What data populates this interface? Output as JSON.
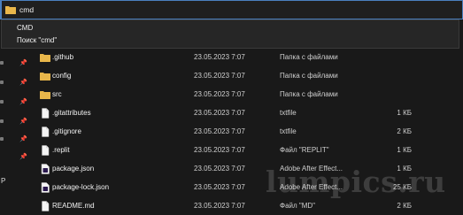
{
  "address": {
    "value": "cmd"
  },
  "suggestions": [
    "CMD",
    "Поиск \"cmd\""
  ],
  "left_pane": {
    "visible_letter": "P"
  },
  "files": [
    {
      "name": ".github",
      "date": "23.05.2023 7:07",
      "type": "Папка с файлами",
      "size": "",
      "kind": "folder"
    },
    {
      "name": "config",
      "date": "23.05.2023 7:07",
      "type": "Папка с файлами",
      "size": "",
      "kind": "folder"
    },
    {
      "name": "src",
      "date": "23.05.2023 7:07",
      "type": "Папка с файлами",
      "size": "",
      "kind": "folder"
    },
    {
      "name": ".gitattributes",
      "date": "23.05.2023 7:07",
      "type": "txtfile",
      "size": "1 КБ",
      "kind": "file"
    },
    {
      "name": ".gitignore",
      "date": "23.05.2023 7:07",
      "type": "txtfile",
      "size": "2 КБ",
      "kind": "file"
    },
    {
      "name": ".replit",
      "date": "23.05.2023 7:07",
      "type": "Файл \"REPLIT\"",
      "size": "1 КБ",
      "kind": "file"
    },
    {
      "name": "package.json",
      "date": "23.05.2023 7:07",
      "type": "Adobe After Effect...",
      "size": "1 КБ",
      "kind": "file-ae"
    },
    {
      "name": "package-lock.json",
      "date": "23.05.2023 7:07",
      "type": "Adobe After Effect...",
      "size": "25 КБ",
      "kind": "file-ae"
    },
    {
      "name": "README.md",
      "date": "23.05.2023 7:07",
      "type": "Файл \"MD\"",
      "size": "2 КБ",
      "kind": "file"
    }
  ],
  "watermark": "lumpics.ru",
  "colors": {
    "folder": "#e8b64a",
    "accent": "#4a7fbf",
    "background": "#191919"
  }
}
